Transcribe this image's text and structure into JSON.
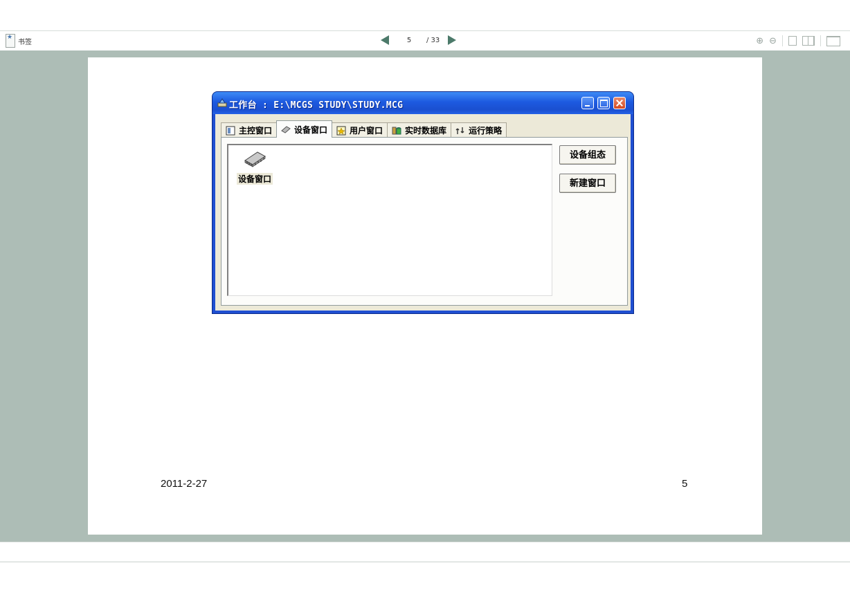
{
  "viewer": {
    "bookmark_label": "书签",
    "page_current": "5",
    "page_total": "/ 33",
    "icons": [
      "bookmark-icon",
      "prev-page-icon",
      "next-page-icon",
      "zoom-in-icon",
      "zoom-out-icon",
      "single-page-icon",
      "two-page-icon",
      "fullscreen-icon"
    ]
  },
  "window": {
    "title": "工作台 : E:\\MCGS STUDY\\STUDY.MCG",
    "tabs": [
      {
        "label": "主控窗口",
        "icon": "main-window-icon"
      },
      {
        "label": "设备窗口",
        "icon": "device-chip-icon",
        "active": true
      },
      {
        "label": "用户窗口",
        "icon": "user-window-icon"
      },
      {
        "label": "实时数据库",
        "icon": "database-icon"
      },
      {
        "label": "运行策略",
        "icon": "strategy-icon"
      }
    ],
    "list_item": {
      "label": "设备窗口",
      "icon": "device-chip-icon"
    },
    "buttons": {
      "configure": "设备组态",
      "new_window": "新建窗口"
    }
  },
  "slide_footer": {
    "date": "2011-2-27",
    "page": "5"
  },
  "colors": {
    "titlebar": "#1d5ae0",
    "workspace": "#adbdb6",
    "window_face": "#ece9d8"
  }
}
